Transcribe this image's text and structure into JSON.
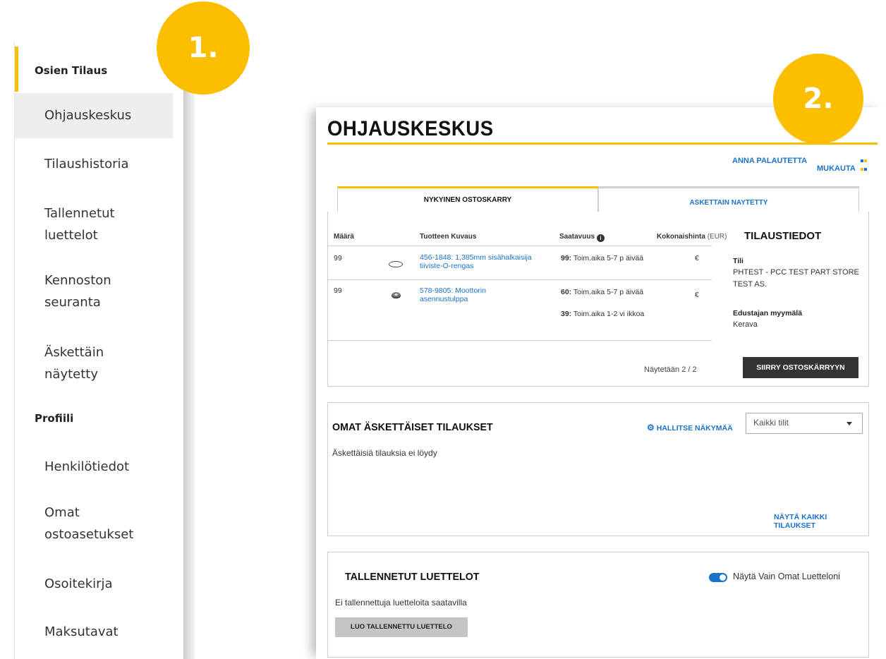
{
  "badges": {
    "first": "1.",
    "second": "2."
  },
  "sidebar": {
    "section_order": "Osien Tilaus",
    "item_dashboard": "Ohjauskeskus",
    "item_order_history": "Tilaushistoria",
    "item_saved_lists": "Tallennetut luettelot",
    "item_fleet": "Kennoston seuranta",
    "item_recent": "Äskettäin näytetty",
    "section_profile": "Profiili",
    "item_personal": "Henkilötiedot",
    "item_purchase_settings": "Omat ostoasetukset",
    "item_address_book": "Osoitekirja",
    "item_payment": "Maksutavat"
  },
  "header": {
    "title": "OHJAUSKESKUS",
    "feedback": "ANNA PALAUTETTA",
    "customize": "MUKAUTA"
  },
  "tabs": {
    "current_cart": "NYKYINEN OSTOSKARRY",
    "recent": "ASKETTAIN NAYTETTY"
  },
  "cart": {
    "columns": {
      "qty": "Määrä",
      "desc": "Tuotteen Kuvaus",
      "avail": "Saatavuus",
      "total": "Kokonaishinta",
      "currency": "(EUR)"
    },
    "rows": [
      {
        "qty": "99",
        "desc": "456-1848: 1,385mm sisähalkaisija tiiviste-O-rengas",
        "avail_num": "99:",
        "avail_text": "Toim.aika 5-7 p äivää",
        "price": "€"
      },
      {
        "qty": "99",
        "desc": "578-9805: Moottorin asennustulppa",
        "avail_num": "60:",
        "avail_text": "Toim.aika 5-7 p äivää",
        "avail2_num": "39:",
        "avail2_text": "Toim.aika 1-2 vi ikkoa",
        "price": "€"
      }
    ],
    "showing": "Näytetään 2 / 2",
    "checkout_button": "SIIRRY OSTOSKÄRRYYN"
  },
  "order_info": {
    "title": "TILAUSTIEDOT",
    "account_label": "Tili",
    "account_value": "PHTEST - PCC TEST PART STORE TEST AS.",
    "store_label": "Edustajan myymälä",
    "store_value": "Kerava"
  },
  "orders": {
    "title": "OMAT ÄSKETTÄISET TILAUKSET",
    "manage": "HALLITSE NÄKYMÄÄ",
    "account_select": "Kaikki tilit",
    "empty": "Äskettäisiä tilauksia ei löydy",
    "view_all": "NÄYTÄ KAIKKI TILAUKSET"
  },
  "lists": {
    "title": "TALLENNETUT LUETTELOT",
    "toggle_label": "Näytä Vain Omat Luetteloni",
    "empty": "Ei tallennettuja luetteloita saatavilla",
    "create_button": "LUO TALLENNETTU LUETTELO"
  }
}
